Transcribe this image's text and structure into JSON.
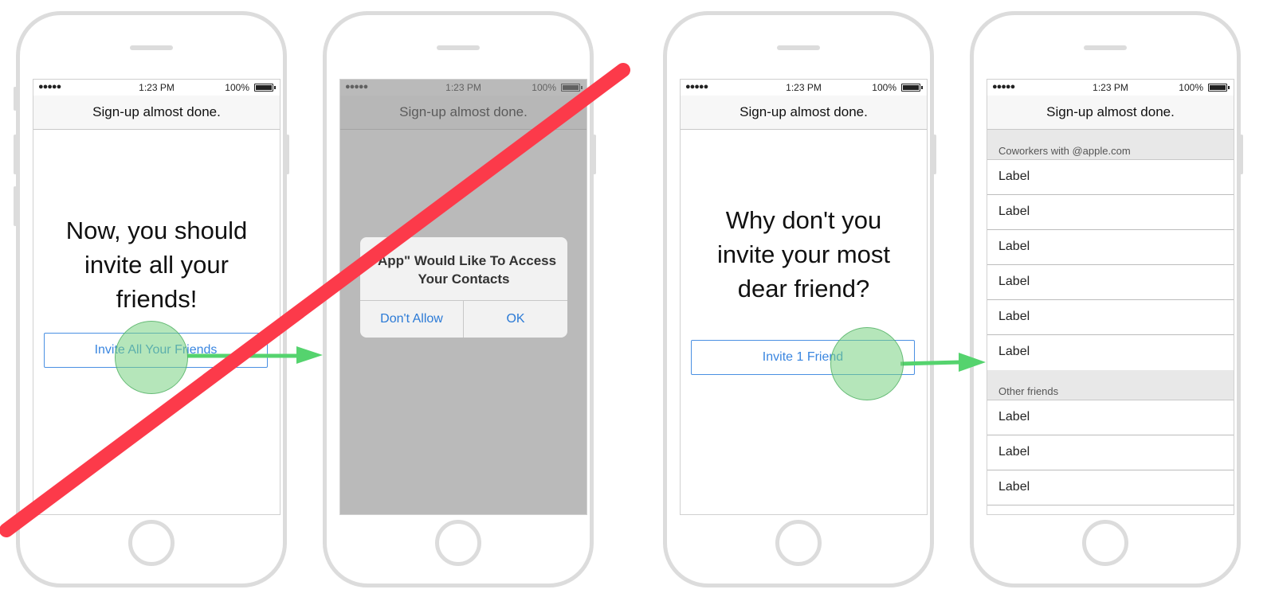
{
  "status_bar": {
    "signal": "●●●●●",
    "time": "1:23 PM",
    "battery": "100%"
  },
  "nav_title": "Sign-up almost done.",
  "screen1": {
    "headline": "Now, you should invite all your friends!",
    "button_label": "Invite All Your Friends"
  },
  "screen2": {
    "alert_title": "\"App\" Would Like To Access Your Contacts",
    "deny_label": "Don't Allow",
    "ok_label": "OK"
  },
  "screen3": {
    "headline": "Why don't you invite your most dear friend?",
    "button_label": "Invite 1 Friend"
  },
  "screen4": {
    "section1_header": "Coworkers with @apple.com",
    "section1_rows": [
      "Label",
      "Label",
      "Label",
      "Label",
      "Label",
      "Label"
    ],
    "section2_header": "Other friends",
    "section2_rows": [
      "Label",
      "Label",
      "Label"
    ]
  },
  "colors": {
    "accent_blue": "#3a86e0",
    "arrow_green": "#55d36e",
    "touch_green": "#7ed28a",
    "strike_red": "#fc3a4a"
  },
  "icons": {
    "touch": "touch-indicator-icon",
    "flow_arrow": "flow-arrow-icon",
    "strike": "rejected-strike-icon"
  }
}
